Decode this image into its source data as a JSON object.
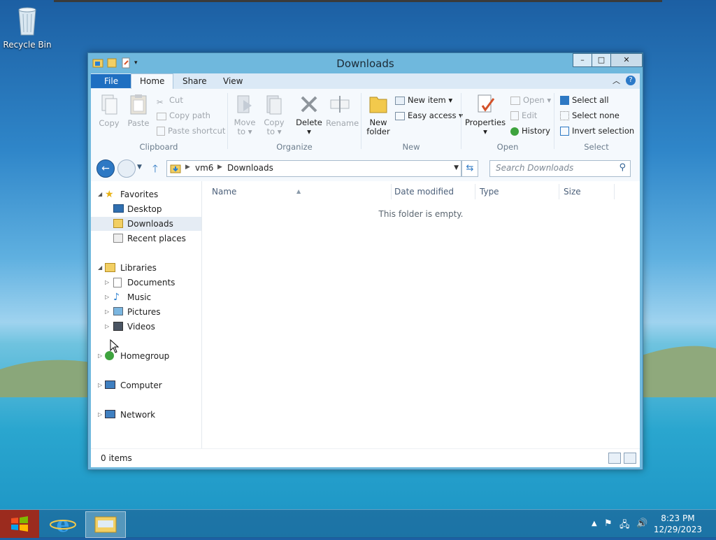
{
  "desktop": {
    "recycle_bin_label": "Recycle Bin"
  },
  "window": {
    "title": "Downloads",
    "buttons": {
      "minimize": "–",
      "maximize": "□",
      "close": "✕"
    }
  },
  "ribbon_tabs": {
    "file": "File",
    "home": "Home",
    "share": "Share",
    "view": "View"
  },
  "ribbon": {
    "clipboard": {
      "group": "Clipboard",
      "copy": "Copy",
      "paste": "Paste",
      "cut": "Cut",
      "copy_path": "Copy path",
      "paste_shortcut": "Paste shortcut"
    },
    "organize": {
      "group": "Organize",
      "move_to_1": "Move",
      "move_to_2": "to",
      "copy_to_1": "Copy",
      "copy_to_2": "to",
      "delete": "Delete",
      "rename": "Rename"
    },
    "new": {
      "group": "New",
      "new_folder_1": "New",
      "new_folder_2": "folder",
      "new_item": "New item",
      "easy_access": "Easy access"
    },
    "open": {
      "group": "Open",
      "properties": "Properties",
      "open": "Open",
      "edit": "Edit",
      "history": "History"
    },
    "select": {
      "group": "Select",
      "select_all": "Select all",
      "select_none": "Select none",
      "invert_selection": "Invert selection"
    }
  },
  "address": {
    "crumbs": [
      "vm6",
      "Downloads"
    ],
    "search_placeholder": "Search Downloads"
  },
  "nav": {
    "favorites": "Favorites",
    "desktop": "Desktop",
    "downloads": "Downloads",
    "recent": "Recent places",
    "libraries": "Libraries",
    "documents": "Documents",
    "music": "Music",
    "pictures": "Pictures",
    "videos": "Videos",
    "homegroup": "Homegroup",
    "computer": "Computer",
    "network": "Network"
  },
  "columns": {
    "name": "Name",
    "date_modified": "Date modified",
    "type": "Type",
    "size": "Size"
  },
  "empty_message": "This folder is empty.",
  "status": {
    "item_count": "0 items"
  },
  "taskbar": {
    "time": "8:23 PM",
    "date": "12/29/2023"
  }
}
